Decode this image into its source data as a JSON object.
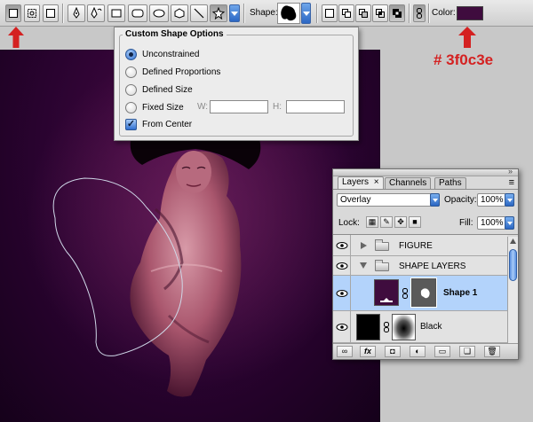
{
  "options_bar": {
    "shape_label": "Shape:",
    "color_label": "Color:",
    "color_value": "#3f0c3e",
    "accent_color": "#3f0c3e",
    "icons": [
      "shape-layers-icon",
      "paths-icon",
      "fill-pixels-icon",
      "pen-icon",
      "freeform-pen-icon",
      "rectangle-icon",
      "rounded-rectangle-icon",
      "ellipse-icon",
      "polygon-icon",
      "line-icon",
      "custom-shape-icon",
      "geometry-options-icon",
      "combine-icons",
      "link-icon"
    ]
  },
  "annotation": {
    "hex_note": "# 3f0c3e",
    "arrow_color": "#d42121"
  },
  "custom_shape_options": {
    "title": "Custom Shape Options",
    "options": [
      {
        "label": "Unconstrained",
        "selected": true
      },
      {
        "label": "Defined Proportions",
        "selected": false
      },
      {
        "label": "Defined Size",
        "selected": false
      },
      {
        "label": "Fixed Size",
        "selected": false
      }
    ],
    "w_label": "W:",
    "h_label": "H:",
    "w_value": "",
    "h_value": "",
    "from_center_label": "From Center",
    "from_center_checked": true
  },
  "layers_panel": {
    "tabs": [
      {
        "label": "Layers",
        "active": true,
        "close": "×"
      },
      {
        "label": "Channels",
        "active": false
      },
      {
        "label": "Paths",
        "active": false
      }
    ],
    "blend_mode": "Overlay",
    "opacity_label": "Opacity:",
    "opacity_value": "100%",
    "lock_label": "Lock:",
    "fill_label": "Fill:",
    "fill_value": "100%",
    "layers": [
      {
        "name": "FIGURE",
        "type": "group",
        "expanded": false
      },
      {
        "name": "SHAPE LAYERS",
        "type": "group",
        "expanded": true
      },
      {
        "name": "Shape 1",
        "type": "shape",
        "selected": true
      },
      {
        "name": "Black",
        "type": "pixel",
        "selected": false
      }
    ],
    "footer_icons": [
      "link-layers-icon",
      "fx-icon",
      "mask-icon",
      "adjustment-icon",
      "new-group-icon",
      "new-layer-icon",
      "trash-icon"
    ]
  }
}
